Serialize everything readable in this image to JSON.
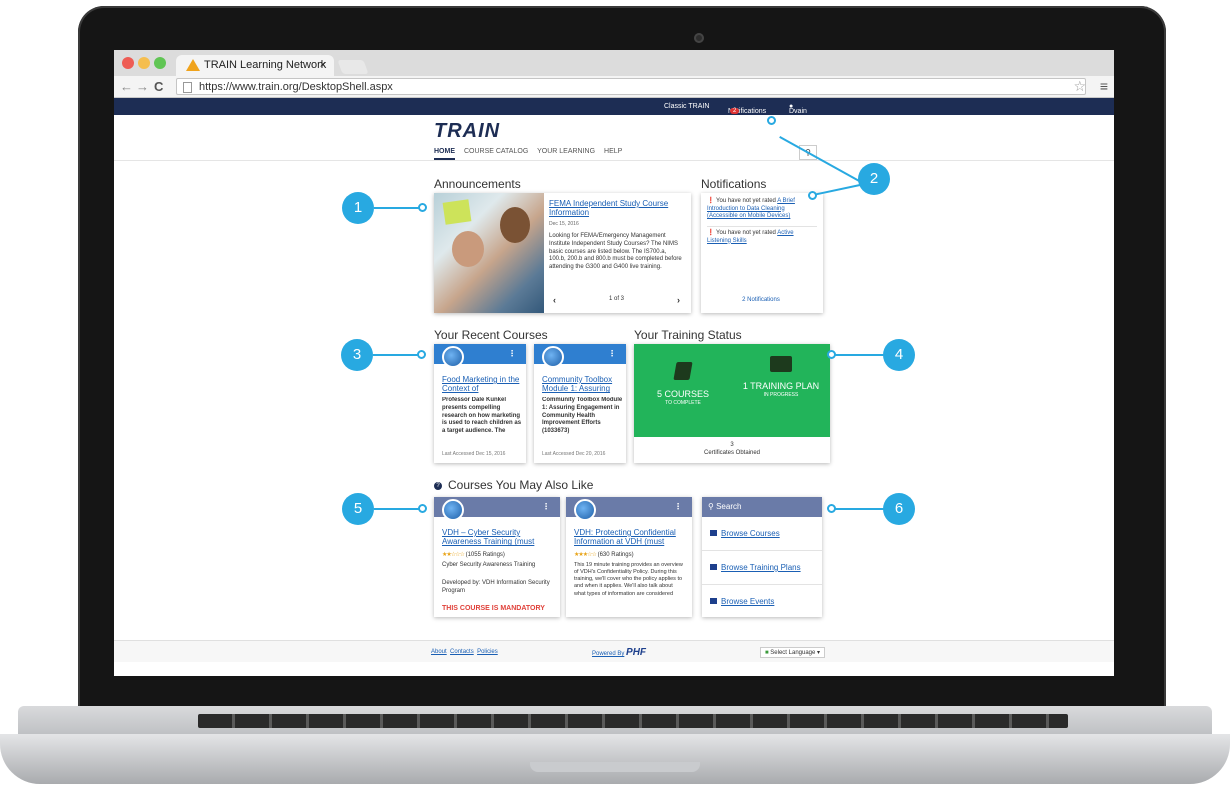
{
  "browser": {
    "tab_title": "TRAIN Learning Network",
    "tab_close": "×",
    "url": "https://www.train.org/DesktopShell.aspx",
    "back": "←",
    "forward": "→",
    "reload": "C",
    "traffic_colors": [
      "#ee5c54",
      "#f5be4f",
      "#60c554"
    ]
  },
  "topnav": {
    "classic": "Classic TRAIN",
    "notifications": "Notifications",
    "notifications_count": "2",
    "user": "Dvain"
  },
  "header": {
    "logo": "TRAIN",
    "nav": [
      "HOME",
      "COURSE CATALOG",
      "YOUR LEARNING",
      "HELP"
    ],
    "search_icon": "search-icon"
  },
  "announcements": {
    "title": "Announcements",
    "item_title": "FEMA Independent Study Course Information",
    "date": "Dec 15, 2016",
    "body": "Looking for FEMA/Emergency Management Institute Independent Study Courses? The NIMS basic courses are listed below. The IS700.a, 100.b, 200.b and 800.b must be completed before attending the G300 and G400 live training.",
    "pager": "1 of 3",
    "prev": "‹",
    "next": "›"
  },
  "notifications": {
    "title": "Notifications",
    "items": [
      {
        "prefix": "You have not yet rated ",
        "link": "A Brief Introduction to Data Cleaning (Accessible on Mobile Devices)"
      },
      {
        "prefix": "You have not yet rated ",
        "link": "Active Listening Skills"
      }
    ],
    "footer": "2 Notifications"
  },
  "recent_courses": {
    "title": "Your Recent Courses",
    "cards": [
      {
        "title": "Food Marketing in the Context of",
        "body": "Professor Dale Kunkel presents compelling research on how marketing is used to reach children as a target audience. The",
        "footer": "Last Accessed Dec 15, 2016"
      },
      {
        "title": "Community Toolbox Module 1: Assuring",
        "body": "Community Toolbox Module 1: Assuring Engagement in Community Health Improvement Efforts (1033673)",
        "footer": "Last Accessed Dec 20, 2016"
      }
    ],
    "kebab": "⋮",
    "head_color": "#2f7fd0"
  },
  "training_status": {
    "title": "Your Training Status",
    "courses_big": "5 COURSES",
    "courses_small": "TO COMPLETE",
    "plan_big": "1 TRAINING PLAN",
    "plan_small": "IN PROGRESS",
    "certificates_count": "3",
    "certificates_label": "Certificates Obtained",
    "color": "#22b45a"
  },
  "also_like": {
    "title": "Courses You May Also Like",
    "info_icon": "?",
    "cards": [
      {
        "title": "VDH – Cyber Security Awareness Training (must",
        "stars": "★★☆☆☆",
        "ratings": "(1055 Ratings)",
        "body1": "Cyber Security Awareness Training",
        "body2": "Developed by:  VDH Information Security Program",
        "mandatory": "THIS COURSE IS MANDATORY"
      },
      {
        "title": "VDH: Protecting Confidential Information at VDH (must",
        "stars": "★★★☆☆",
        "ratings": "(630 Ratings)",
        "body1": "This 19 minute training provides an overview of VDH's Confidentiality Policy.  During this training, we'll cover who the policy applies to and when it applies.  We'll also talk about what types of information are considered"
      }
    ],
    "head_color": "#6a7ba8"
  },
  "search_panel": {
    "title": "Search",
    "links": [
      "Browse Courses",
      "Browse Training Plans",
      "Browse Events"
    ]
  },
  "footer": {
    "links": [
      "About",
      "Contacts",
      "Policies"
    ],
    "powered_by": "Powered By",
    "powered_logo": "PHF",
    "language": "Select Language"
  },
  "callouts": [
    "1",
    "2",
    "3",
    "4",
    "5",
    "6"
  ]
}
